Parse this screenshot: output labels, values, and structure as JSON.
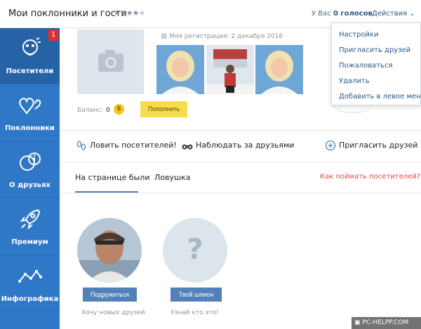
{
  "header": {
    "title": "Мои поклонники и гости",
    "stars_filled": "★★★★",
    "stars_empty": "★",
    "votes_prefix": "У Вас",
    "votes_value": "0 голосов",
    "actions_label": "Действия ⌄"
  },
  "dropdown": {
    "items": [
      "Настройки",
      "Пригласить друзей",
      "Пожаловаться",
      "Удалить",
      "Добавить в левое меню"
    ]
  },
  "sidebar": {
    "items": [
      {
        "label": "Посетители",
        "badge": "1",
        "icon": "visitors-icon"
      },
      {
        "label": "Поклонники",
        "icon": "hearts-icon"
      },
      {
        "label": "О друзьях",
        "icon": "friends-info-icon"
      },
      {
        "label": "Премиум",
        "icon": "rocket-icon"
      },
      {
        "label": "Инфографика",
        "icon": "chart-line-icon"
      }
    ]
  },
  "profile": {
    "registration": "Моя регистрация: 2 декабря 2016",
    "balance_label": "Баланс:",
    "balance_value": "0",
    "coin_symbol": "$",
    "topup_label": "Пополнить"
  },
  "actions_row": {
    "catch_visitors": "Ловить посетителей!",
    "watch_friends": "Наблюдать за друзьями",
    "invite_friends": "Пригласить друзей"
  },
  "tabs": {
    "items": [
      "На странице были",
      "Ловушка"
    ],
    "howto_link": "Как поймать посетителей?"
  },
  "cards": [
    {
      "button": "Подружиться",
      "caption": "Хочу новых друзей"
    },
    {
      "button": "Твой шпион",
      "caption": "Узнай кто это!",
      "placeholder": "?"
    }
  ],
  "watermark": "PC-HELPP.COM",
  "colors": {
    "sidebar": "#2f78c7",
    "accent_button": "#5181b8",
    "topup": "#f7dd4d",
    "badge": "#e52d2d",
    "link": "#2a5885"
  }
}
